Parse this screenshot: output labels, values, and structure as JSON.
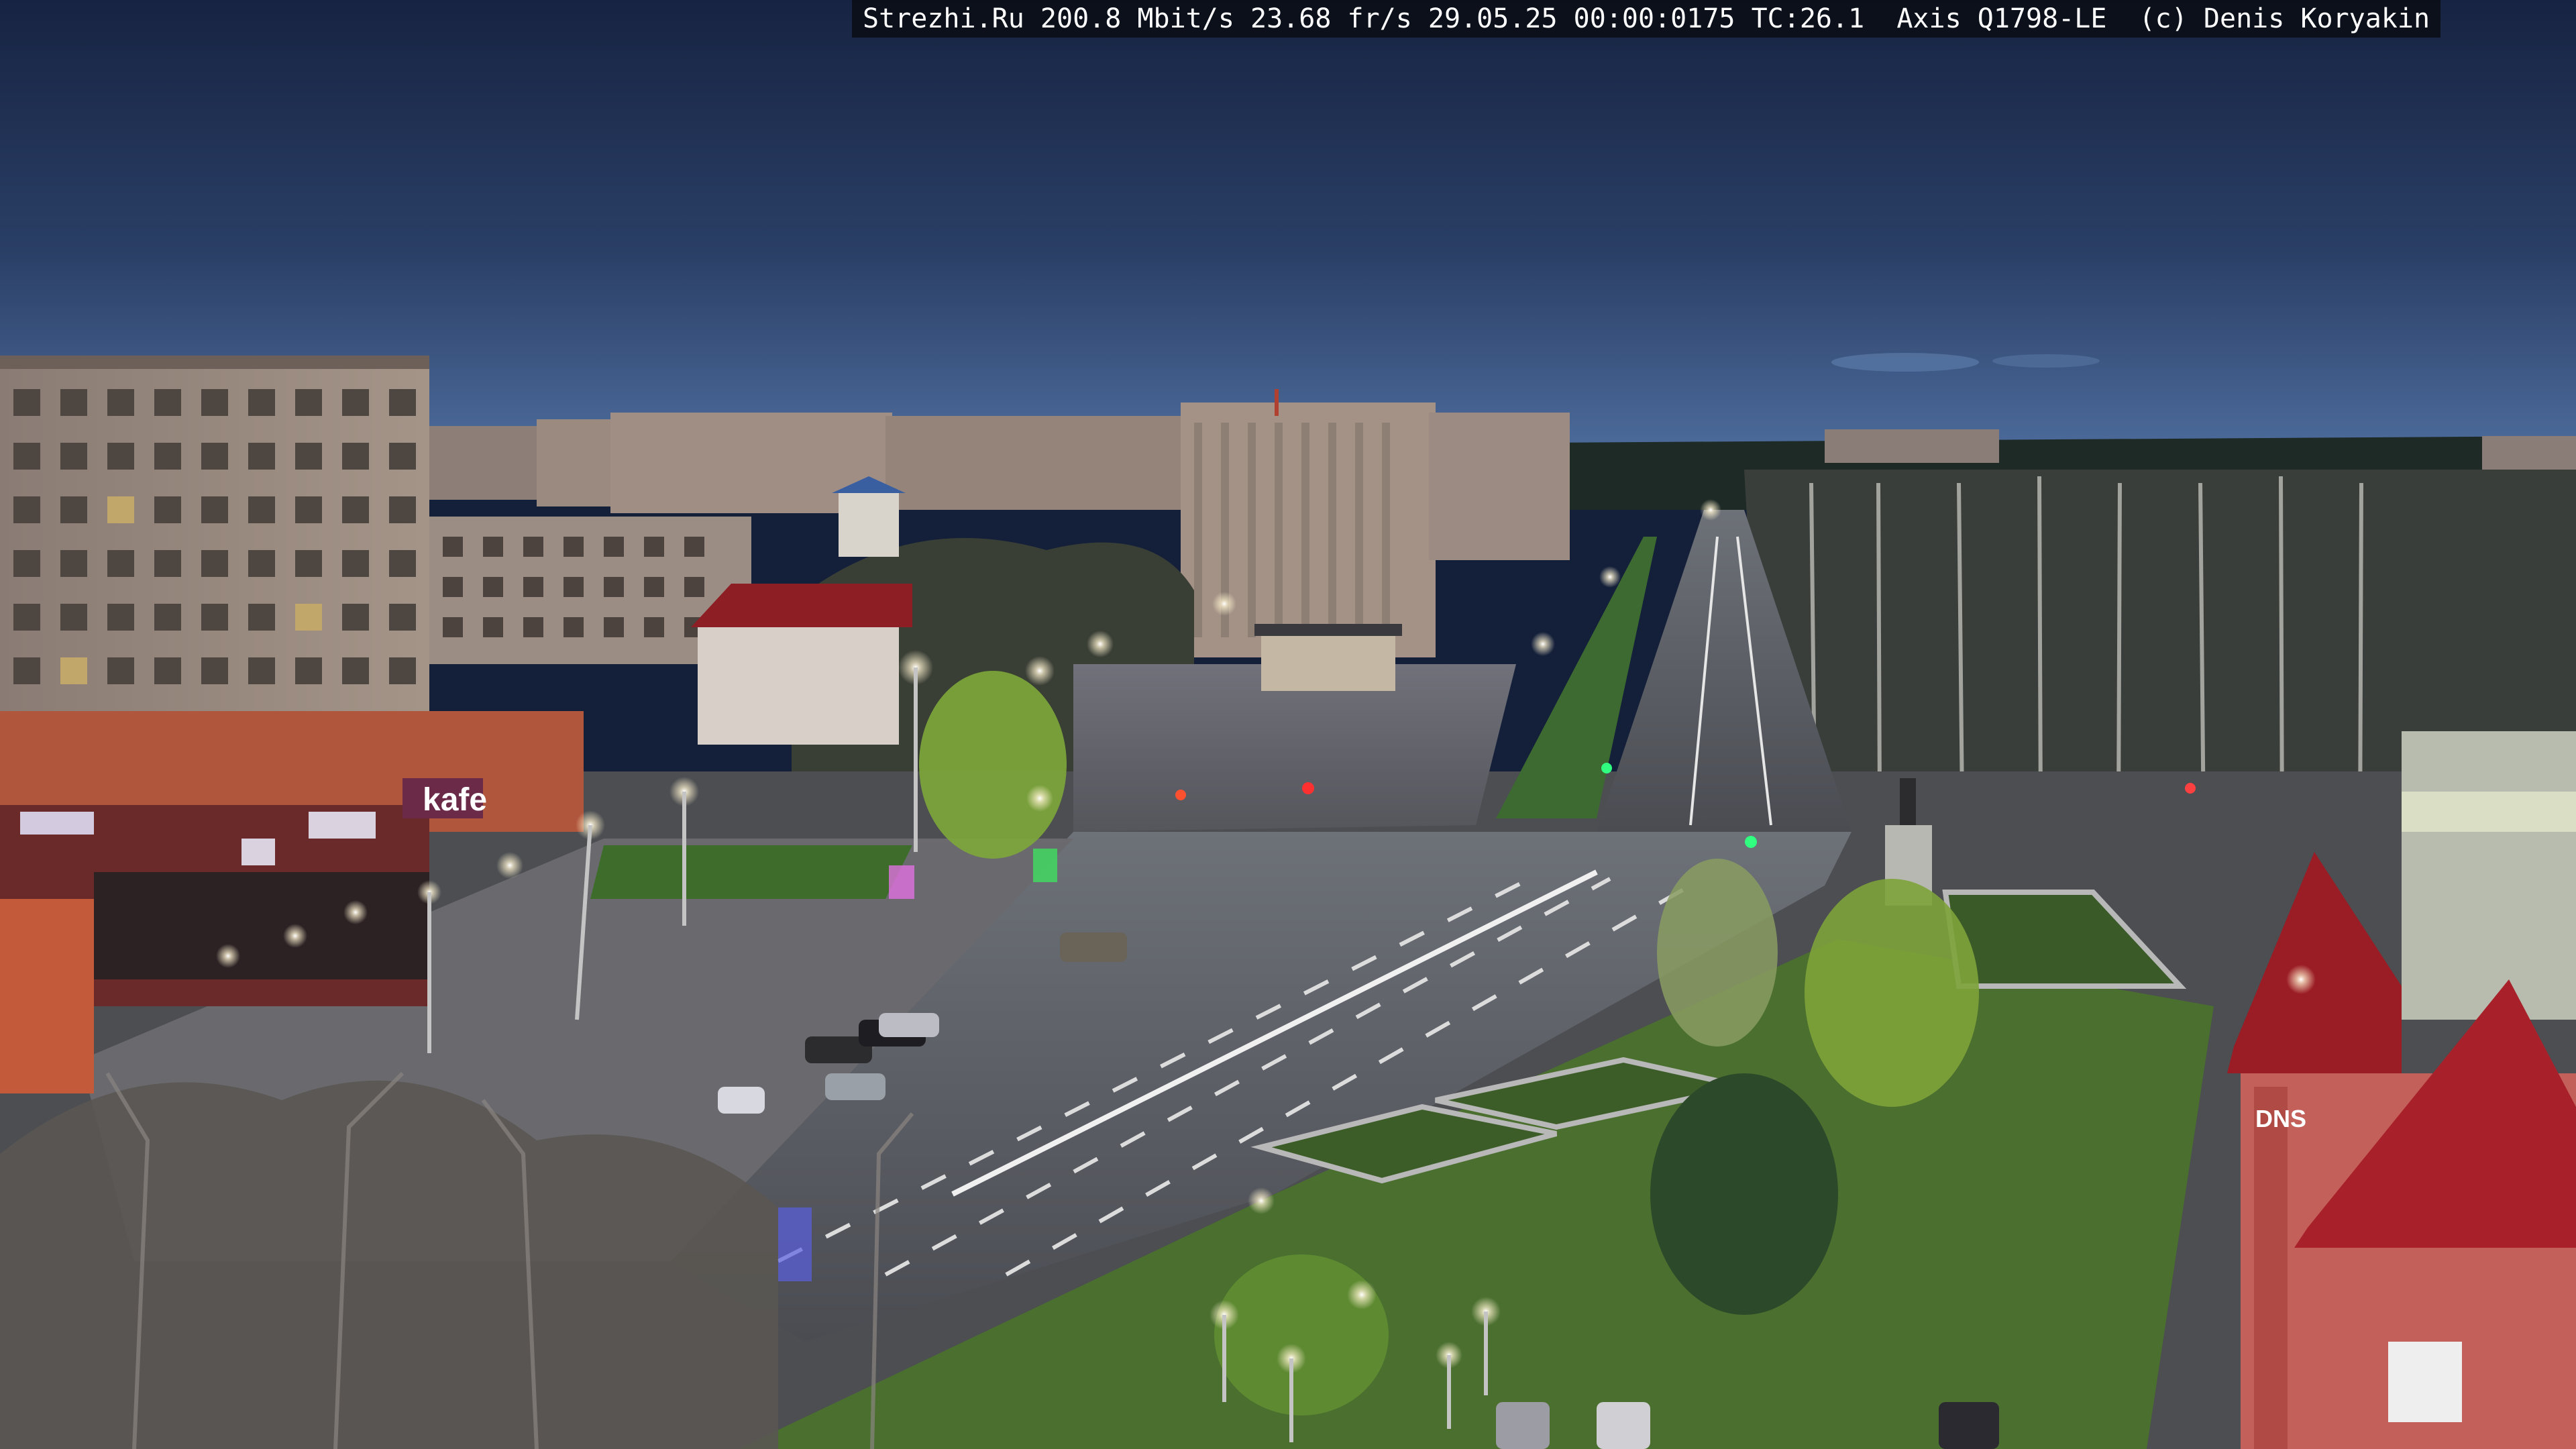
{
  "overlay": {
    "site": "Strezhi.Ru",
    "bitrate": "200.8 Mbit/s",
    "framerate": "23.68 fr/s",
    "date": "29.05.25",
    "time": "00:00:0175",
    "tc": "TC:26.1",
    "camera": "Axis Q1798-LE",
    "credit": "(c) Denis Koryakin"
  },
  "signs": {
    "cafe": "kafe",
    "store": "DNS"
  },
  "colors": {
    "sky_top": "#1a2748",
    "sky_horizon": "#4a6a9a",
    "road": "#55585e",
    "grass": "#3b6b2a",
    "roof_red": "#9a1c24",
    "lamp_glow": "#fff3d0"
  }
}
